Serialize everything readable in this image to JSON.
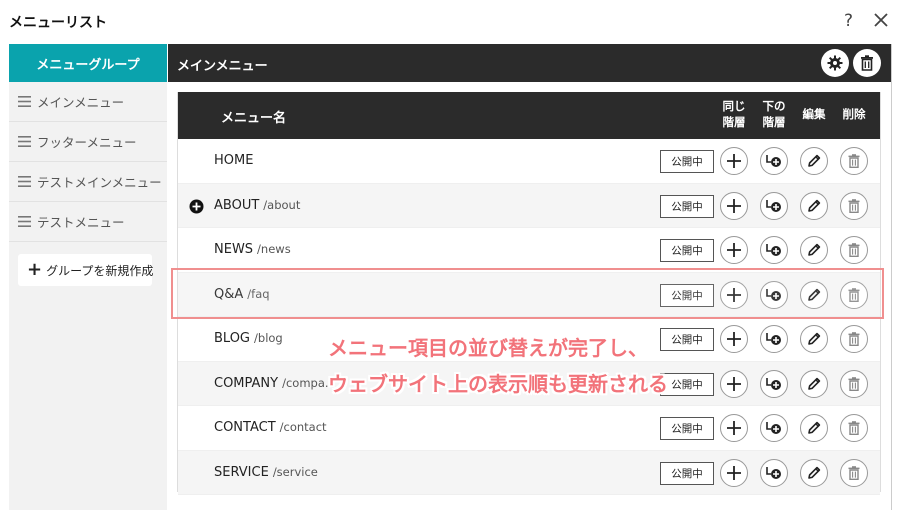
{
  "window": {
    "title": "メニューリスト",
    "help": "?"
  },
  "sidebar": {
    "header": "メニューグループ",
    "items": [
      {
        "label": "メインメニュー"
      },
      {
        "label": "フッターメニュー"
      },
      {
        "label": "テストメインメニュー"
      },
      {
        "label": "テストメニュー"
      }
    ],
    "add_button": {
      "plus": "+",
      "label": "グループを新規作成"
    }
  },
  "main": {
    "title": "メインメニュー",
    "table": {
      "columns": {
        "name": "メニュー名",
        "same_level": [
          "同じ",
          "階層"
        ],
        "lower_level": [
          "下の",
          "階層"
        ],
        "edit": "編集",
        "delete": "削除"
      },
      "rows": [
        {
          "name": "HOME",
          "path": "",
          "status": "公開中",
          "expandable": false
        },
        {
          "name": "ABOUT",
          "path": "/about",
          "status": "公開中",
          "expandable": true
        },
        {
          "name": "NEWS",
          "path": "/news",
          "status": "公開中",
          "expandable": false
        },
        {
          "name": "Q&A",
          "path": "/faq",
          "status": "公開中",
          "expandable": false
        },
        {
          "name": "BLOG",
          "path": "/blog",
          "status": "公開中",
          "expandable": false
        },
        {
          "name": "COMPANY",
          "path": "/compa...",
          "status": "公開中",
          "expandable": false
        },
        {
          "name": "CONTACT",
          "path": "/contact",
          "status": "公開中",
          "expandable": false
        },
        {
          "name": "SERVICE",
          "path": "/service",
          "status": "公開中",
          "expandable": false
        }
      ]
    }
  },
  "annotation": {
    "line1": "メニュー項目の並び替えが完了し、",
    "line2": "ウェブサイト上の表示順も更新される"
  },
  "colors": {
    "accent": "#0aa3ad",
    "dark_header": "#2b2b2b",
    "annotation": "#f2737a"
  },
  "icons": {
    "close": "close-icon",
    "settings": "gear-icon",
    "trash": "trash-icon",
    "plus": "plus-icon",
    "add_child": "add-child-icon",
    "edit": "pencil-icon",
    "expand": "plus-circle-icon",
    "menu": "hamburger-icon"
  }
}
